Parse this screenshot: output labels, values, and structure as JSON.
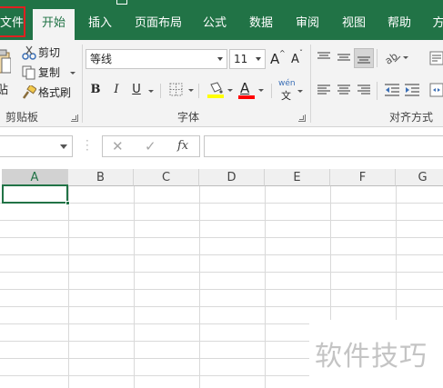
{
  "ribbon_tabs": {
    "file": "文件",
    "home": "开始",
    "insert": "插入",
    "page_layout": "页面布局",
    "formulas": "公式",
    "data": "数据",
    "review": "审阅",
    "view": "视图",
    "help": "帮助",
    "more": "方"
  },
  "clipboard": {
    "paste": "贴",
    "cut": "剪切",
    "copy": "复制",
    "format_painter": "格式刷",
    "group_label": "剪贴板"
  },
  "font": {
    "font_name": "等线",
    "font_size": "11",
    "grow": "A",
    "shrink": "A",
    "bold": "B",
    "italic": "I",
    "underline": "U",
    "font_color_letter": "A",
    "phonetic_top": "wén",
    "phonetic_bottom": "文",
    "group_label": "字体"
  },
  "alignment": {
    "group_label": "对齐方式"
  },
  "formula_bar": {
    "cancel": "✕",
    "enter": "✓",
    "fx": "fx",
    "value": ""
  },
  "grid": {
    "columns": [
      "A",
      "B",
      "C",
      "D",
      "E",
      "F",
      "G"
    ],
    "selected_column": "A"
  },
  "watermark": "软件技巧",
  "colors": {
    "excel_green": "#217346",
    "highlight_red": "#e02020",
    "fill_yellow": "#ffff00",
    "font_red": "#ff0000"
  }
}
